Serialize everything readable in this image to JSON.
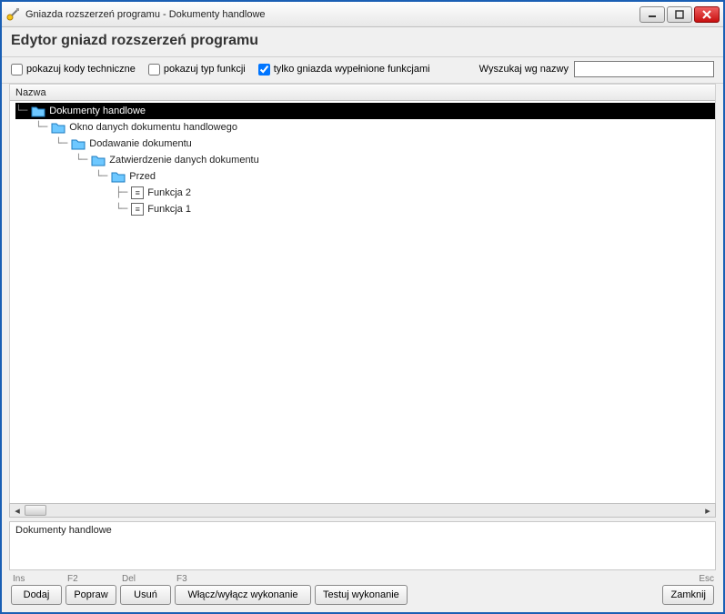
{
  "window": {
    "title": "Gniazda rozszerzeń programu - Dokumenty handlowe"
  },
  "header": {
    "title": "Edytor gniazd rozszerzeń programu"
  },
  "toolbar": {
    "show_tech_codes": "pokazuj kody techniczne",
    "show_tech_codes_checked": false,
    "show_func_type": "pokazuj typ funkcji",
    "show_func_type_checked": false,
    "only_filled": "tylko gniazda wypełnione funkcjami",
    "only_filled_checked": true,
    "search_label": "Wyszukaj wg nazwy",
    "search_value": ""
  },
  "tree": {
    "column_header": "Nazwa",
    "nodes": [
      {
        "label": "Dokumenty handlowe",
        "type": "folder",
        "level": 0,
        "selected": true
      },
      {
        "label": "Okno danych dokumentu handlowego",
        "type": "folder",
        "level": 1
      },
      {
        "label": "Dodawanie dokumentu",
        "type": "folder",
        "level": 2
      },
      {
        "label": "Zatwierdzenie danych dokumentu",
        "type": "folder",
        "level": 3
      },
      {
        "label": "Przed",
        "type": "folder",
        "level": 4
      },
      {
        "label": "Funkcja 2",
        "type": "function",
        "level": 5
      },
      {
        "label": "Funkcja 1",
        "type": "function",
        "level": 5
      }
    ]
  },
  "detail": {
    "text": "Dokumenty handlowe"
  },
  "footer": {
    "hints": {
      "add": "Ins",
      "edit": "F2",
      "delete": "Del",
      "toggle": "F3",
      "close": "Esc"
    },
    "buttons": {
      "add": "Dodaj",
      "edit": "Popraw",
      "delete": "Usuń",
      "toggle": "Włącz/wyłącz wykonanie",
      "test": "Testuj wykonanie",
      "close": "Zamknij"
    }
  }
}
